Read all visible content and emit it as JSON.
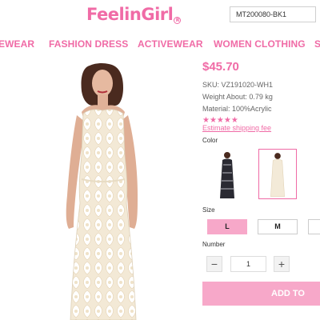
{
  "header": {
    "logo_text": "FeelinGirl",
    "search_value": "MT200080-BK1"
  },
  "nav": {
    "items": [
      "EWEAR",
      "FASHION DRESS",
      "ACTIVEWEAR",
      "WOMEN CLOTHING",
      "S"
    ]
  },
  "product": {
    "price": "$45.70",
    "sku": "SKU: VZ191020-WH1",
    "weight": "Weight About: 0.79 kg",
    "material": "Material: 100%Acrylic",
    "rating_stars": 5,
    "shipping_link": "Estimate shipping fee",
    "color_label": "Color",
    "colors": [
      {
        "name": "black-pattern",
        "selected": false
      },
      {
        "name": "white",
        "selected": true
      }
    ],
    "size_label": "Size",
    "sizes": [
      {
        "label": "L",
        "selected": true
      },
      {
        "label": "M",
        "selected": false
      },
      {
        "label": "",
        "selected": false
      }
    ],
    "number_label": "Number",
    "quantity": "1",
    "minus_symbol": "−",
    "plus_symbol": "+",
    "add_button_label": "ADD TO"
  },
  "colors": {
    "accent": "#f06ba6",
    "button_pink": "#f7a8c9"
  }
}
